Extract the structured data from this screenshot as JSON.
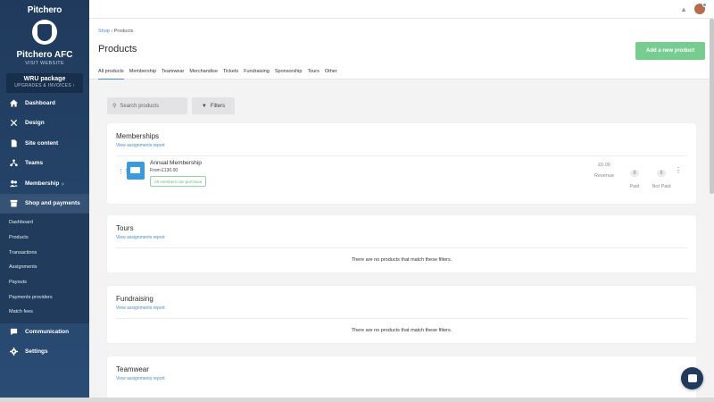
{
  "sidebar": {
    "brand": "Pitchero",
    "club_name": "Pitchero AFC",
    "visit_website": "VISIT WEBSITE",
    "package_title": "WRU package",
    "package_sub": "UPGRADES & INVOICES ›",
    "nav": [
      {
        "label": "Dashboard",
        "icon": "home-icon"
      },
      {
        "label": "Design",
        "icon": "tools-icon"
      },
      {
        "label": "Site content",
        "icon": "document-icon"
      },
      {
        "label": "Teams",
        "icon": "teams-icon"
      },
      {
        "label": "Membership",
        "icon": "people-icon",
        "badge": "β"
      },
      {
        "label": "Shop and payments",
        "icon": "shop-icon"
      }
    ],
    "subnav": [
      "Dashboard",
      "Products",
      "Transactions",
      "Assignments",
      "Payouts",
      "Payments providers",
      "Match fees"
    ],
    "nav_lower": [
      {
        "label": "Communication",
        "icon": "chat-icon"
      },
      {
        "label": "Settings",
        "icon": "gear-icon"
      }
    ]
  },
  "header": {
    "breadcrumb_shop": "Shop",
    "breadcrumb_sep": "›",
    "breadcrumb_current": "Products",
    "title": "Products",
    "add_button": "Add a new product",
    "tabs": [
      "All products",
      "Membership",
      "Teamwear",
      "Merchandise",
      "Tickets",
      "Fundraising",
      "Sponsorship",
      "Tours",
      "Other"
    ]
  },
  "toolbar": {
    "search_placeholder": "Search products",
    "filters_label": "Filters"
  },
  "sections": [
    {
      "title": "Memberships",
      "report_link": "View assignments report",
      "product": {
        "name": "Annual Membership",
        "price": "From £130.00",
        "tag": "All members can purchase",
        "revenue_value": "£0.00",
        "revenue_label": "Revenue",
        "paid_value": "0",
        "paid_label": "Paid",
        "notpaid_value": "0",
        "notpaid_label": "Not Paid"
      }
    },
    {
      "title": "Tours",
      "report_link": "View assignments report",
      "empty": "There are no products that match these filters."
    },
    {
      "title": "Fundraising",
      "report_link": "View assignments report",
      "empty": "There are no products that match these filters."
    },
    {
      "title": "Teamwear",
      "report_link": "View assignments report"
    }
  ],
  "colors": {
    "sidebar": "#1f3a5c",
    "accent": "#4a8ec8",
    "add_button": "#77cc8f"
  }
}
